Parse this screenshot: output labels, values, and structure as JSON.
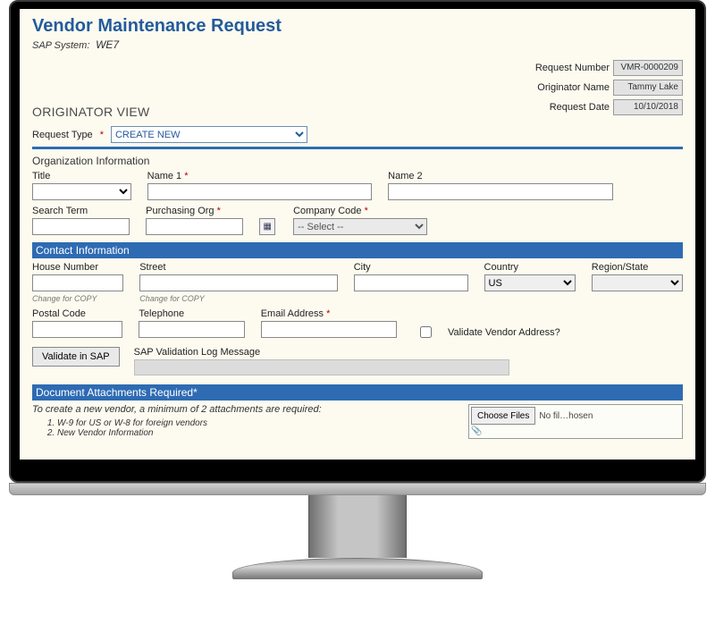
{
  "header": {
    "title": "Vendor Maintenance Request",
    "sap_label": "SAP System:",
    "sap_value": "WE7",
    "orig_view": "ORIGINATOR VIEW"
  },
  "right": {
    "req_num_lbl": "Request Number",
    "req_num_val": "VMR-0000209",
    "orig_name_lbl": "Originator Name",
    "orig_name_val": "Tammy Lake",
    "req_date_lbl": "Request Date",
    "req_date_val": "10/10/2018"
  },
  "req_type": {
    "label": "Request Type",
    "selected": "CREATE NEW"
  },
  "org": {
    "section": "Organization Information",
    "title_lbl": "Title",
    "name1_lbl": "Name 1",
    "name2_lbl": "Name 2",
    "search_lbl": "Search Term",
    "purch_lbl": "Purchasing Org",
    "company_lbl": "Company Code",
    "company_selected": "-- Select --"
  },
  "contact": {
    "section": "Contact Information",
    "house_lbl": "House Number",
    "street_lbl": "Street",
    "city_lbl": "City",
    "country_lbl": "Country",
    "country_val": "US",
    "region_lbl": "Region/State",
    "hint": "Change for COPY",
    "postal_lbl": "Postal Code",
    "tel_lbl": "Telephone",
    "email_lbl": "Email Address",
    "validate_addr_lbl": "Validate Vendor Address?"
  },
  "validate": {
    "btn": "Validate in SAP",
    "log_lbl": "SAP Validation Log Message"
  },
  "attach": {
    "section": "Document Attachments Required*",
    "intro": "To create a new vendor, a minimum of 2 attachments are required:",
    "li1": "W-9 for US or W-8 for foreign vendors",
    "li2": "New Vendor Information",
    "choose_btn": "Choose Files",
    "file_status": "No fil…hosen"
  }
}
